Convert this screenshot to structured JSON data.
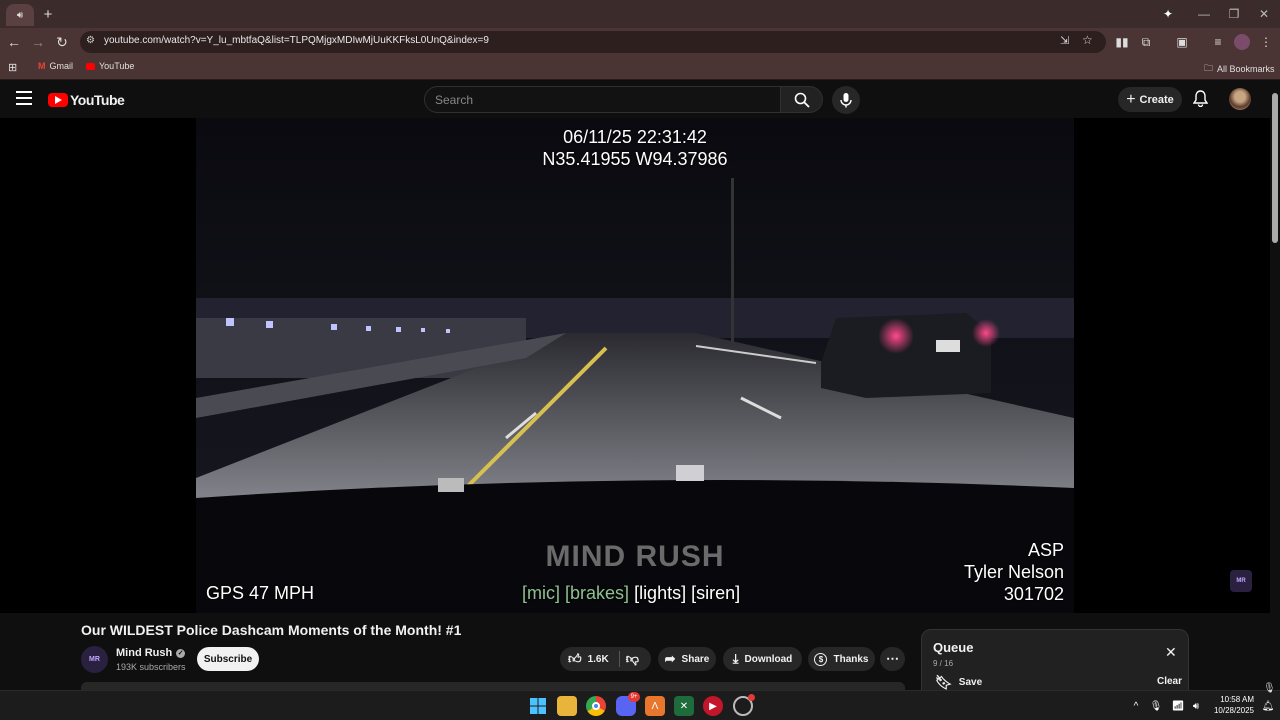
{
  "browser": {
    "url": "youtube.com/watch?v=Y_lu_mbtfaQ&list=TLPQMjgxMDIwMjUuKKFksL0UnQ&index=9",
    "bookmarks": [
      {
        "label": "Gmail",
        "icon": "gmail-icon"
      },
      {
        "label": "YouTube",
        "icon": "youtube-icon"
      }
    ],
    "all_bookmarks": "All Bookmarks"
  },
  "youtube": {
    "logo_text": "YouTube",
    "search_placeholder": "Search",
    "create_label": "Create"
  },
  "video": {
    "timestamp": "06/11/25 22:31:42",
    "coords": "N35.41955 W94.37986",
    "gps": "GPS 47 MPH",
    "status": {
      "mic": "[mic]",
      "brakes": "[brakes]",
      "lights": "[lights]",
      "siren": "[siren]"
    },
    "agency": "ASP",
    "officer": "Tyler Nelson",
    "unit": "301702",
    "watermark": "MIND RUSH"
  },
  "details": {
    "title": "Our WILDEST Police Dashcam Moments of the Month! #1",
    "channel": "Mind Rush",
    "subscribers": "193K subscribers",
    "subscribe_label": "Subscribe",
    "likes": "1.6K",
    "share_label": "Share",
    "download_label": "Download",
    "thanks_label": "Thanks"
  },
  "queue": {
    "title": "Queue",
    "position": "9 / 16",
    "save_label": "Save",
    "clear_label": "Clear"
  },
  "taskbar": {
    "time": "10:58 AM",
    "date": "10/28/2025",
    "discord_badge": "9+"
  },
  "colors": {
    "youtube_red": "#ff0000",
    "browser_frame": "#3b2b2b",
    "page_bg": "#0f0f0f"
  }
}
